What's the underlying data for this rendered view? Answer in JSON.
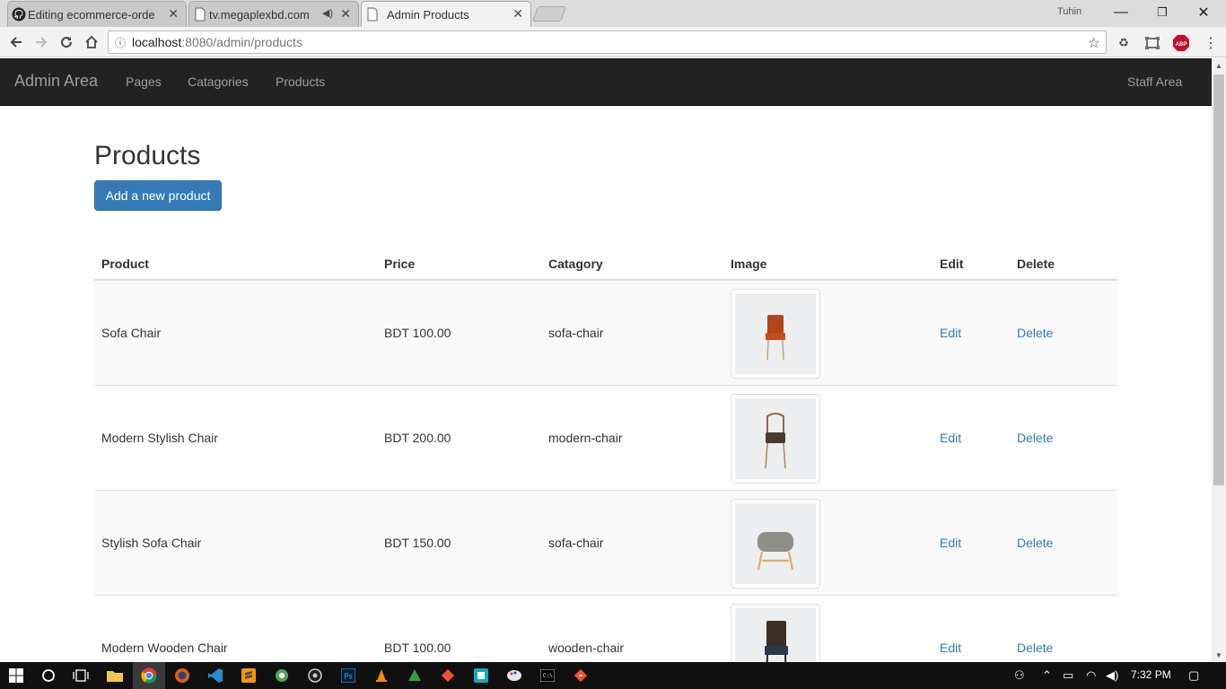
{
  "browser": {
    "tabs": [
      {
        "title": "Editing ecommerce-orde",
        "icon": "github-icon",
        "active": false
      },
      {
        "title": "tv.megaplexbd.com",
        "icon": "page-icon",
        "active": false,
        "audio": true
      },
      {
        "title": "Admin Products",
        "icon": "page-icon",
        "active": true
      }
    ],
    "user": "Tuhin",
    "url_host": "localhost",
    "url_path": ":8080/admin/products"
  },
  "navbar": {
    "brand": "Admin Area",
    "links": [
      "Pages",
      "Catagories",
      "Products"
    ],
    "right_link": "Staff Area"
  },
  "page": {
    "title": "Products",
    "add_button": "Add a new product"
  },
  "table": {
    "headers": [
      "Product",
      "Price",
      "Catagory",
      "Image",
      "Edit",
      "Delete"
    ],
    "rows": [
      {
        "product": "Sofa Chair",
        "price": "BDT 100.00",
        "category": "sofa-chair",
        "image": "orange-chair",
        "edit": "Edit",
        "delete": "Delete"
      },
      {
        "product": "Modern Stylish Chair",
        "price": "BDT 200.00",
        "category": "modern-chair",
        "image": "wooden-armchair",
        "edit": "Edit",
        "delete": "Delete"
      },
      {
        "product": "Stylish Sofa Chair",
        "price": "BDT 150.00",
        "category": "sofa-chair",
        "image": "grey-stool",
        "edit": "Edit",
        "delete": "Delete"
      },
      {
        "product": "Modern Wooden Chair",
        "price": "BDT 100.00",
        "category": "wooden-chair",
        "image": "dark-chair",
        "edit": "Edit",
        "delete": "Delete"
      }
    ]
  },
  "taskbar": {
    "clock": "7:32 PM"
  },
  "colors": {
    "navbar_bg": "#222222",
    "link": "#337ab7",
    "primary_button": "#337ab7",
    "taskbar_bg": "#101010"
  }
}
